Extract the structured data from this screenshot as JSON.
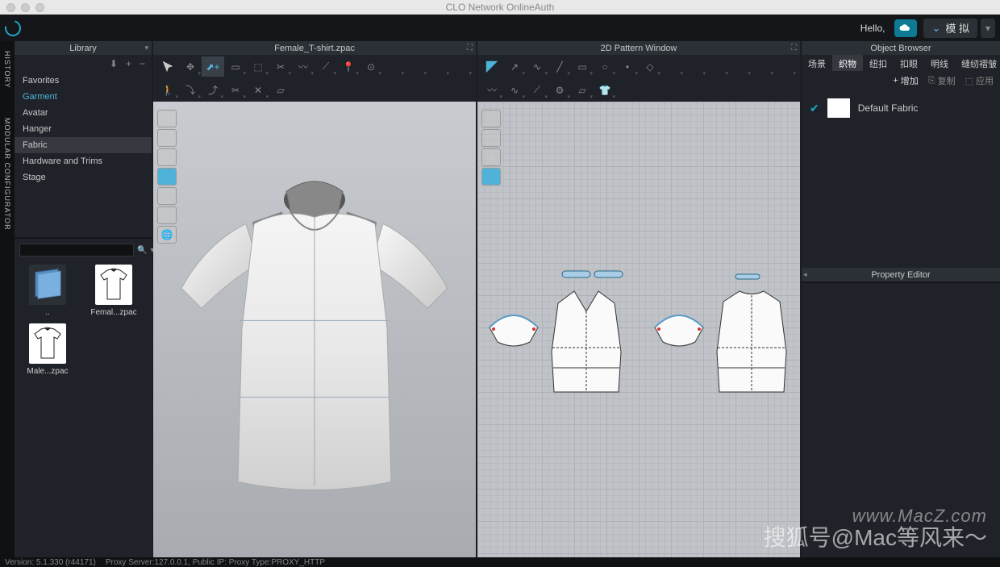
{
  "window": {
    "title": "CLO Network OnlineAuth"
  },
  "header": {
    "hello": "Hello,",
    "simulate": "模 拟"
  },
  "side_tabs": [
    "HISTORY",
    "MODULAR CONFIGURATOR"
  ],
  "library": {
    "title": "Library",
    "items": [
      "Favorites",
      "Garment",
      "Avatar",
      "Hanger",
      "Fabric",
      "Hardware and Trims",
      "Stage"
    ],
    "active_index": 1,
    "thumbs": [
      {
        "label": "..",
        "kind": "folder"
      },
      {
        "label": "Femal...zpac",
        "kind": "shirt"
      },
      {
        "label": "Male...zpac",
        "kind": "shirt"
      }
    ]
  },
  "view3d": {
    "title": "Female_T-shirt.zpac"
  },
  "view2d": {
    "title": "2D Pattern Window"
  },
  "object_browser": {
    "title": "Object Browser",
    "tabs": [
      "场景",
      "织物",
      "纽扣",
      "扣眼",
      "明线",
      "缝纫褶皱"
    ],
    "active_tab": 1,
    "actions": {
      "add": "增加",
      "copy": "复制",
      "apply": "应用"
    },
    "items": [
      {
        "name": "Default Fabric",
        "color": "#ffffff",
        "checked": true
      }
    ]
  },
  "property_editor": {
    "title": "Property Editor"
  },
  "status": {
    "version": "Version: 5.1.330 (r44171)",
    "proxy": "Proxy Server:127.0.0.1, Public IP:  Proxy Type:PROXY_HTTP"
  },
  "watermarks": {
    "w1": "www.MacZ.com",
    "w2": "搜狐号@Mac等风来～"
  }
}
